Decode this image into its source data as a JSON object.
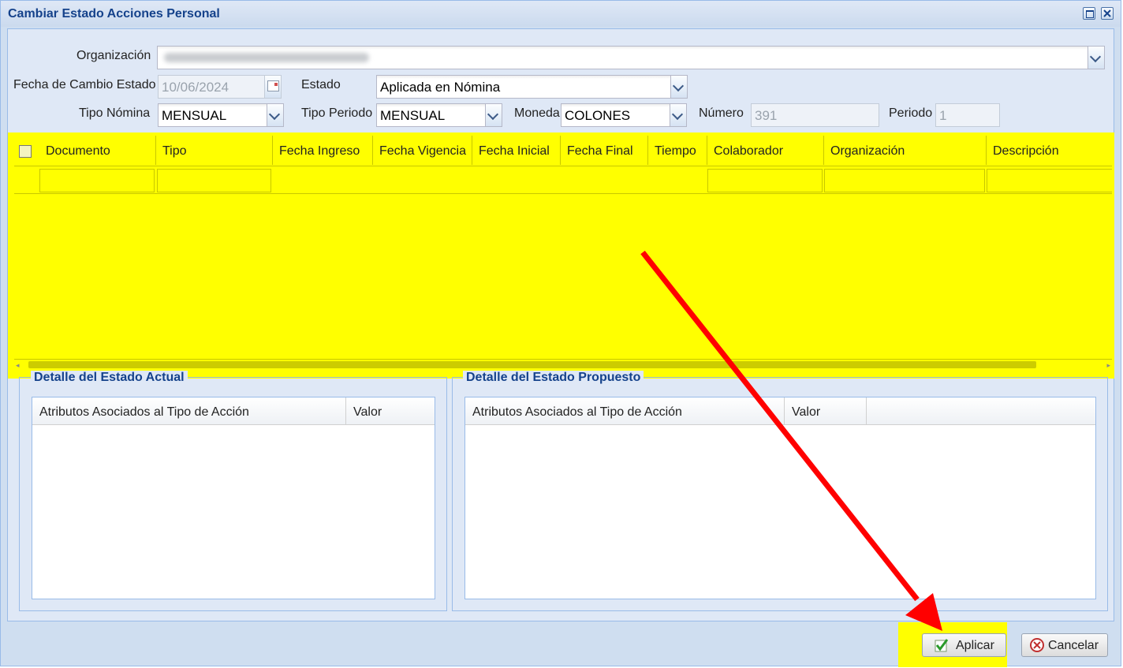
{
  "window": {
    "title": "Cambiar Estado Acciones Personal"
  },
  "form": {
    "organizacion": {
      "label": "Organización"
    },
    "fecha_cambio": {
      "label": "Fecha de Cambio Estado",
      "value": "10/06/2024"
    },
    "estado": {
      "label": "Estado",
      "value": "Aplicada en Nómina"
    },
    "tipo_nomina": {
      "label": "Tipo Nómina",
      "value": "MENSUAL"
    },
    "tipo_periodo": {
      "label": "Tipo Periodo",
      "value": "MENSUAL"
    },
    "moneda": {
      "label": "Moneda",
      "value": "COLONES"
    },
    "numero": {
      "label": "Número",
      "value": "391"
    },
    "periodo": {
      "label": "Periodo",
      "value": "1"
    }
  },
  "grid": {
    "columns": [
      "Documento",
      "Tipo",
      "Fecha Ingreso",
      "Fecha Vigencia",
      "Fecha Inicial",
      "Fecha Final",
      "Tiempo",
      "Colaborador",
      "Organización",
      "Descripción"
    ],
    "highlight_color": "#ffff00"
  },
  "detalle_actual": {
    "title": "Detalle del Estado Actual",
    "col_atributos": "Atributos Asociados al Tipo de Acción",
    "col_valor": "Valor"
  },
  "detalle_propuesto": {
    "title": "Detalle del Estado Propuesto",
    "col_atributos": "Atributos Asociados al Tipo de Acción",
    "col_valor": "Valor"
  },
  "buttons": {
    "aplicar": "Aplicar",
    "cancelar": "Cancelar"
  },
  "annotation": {
    "arrow_color": "#ff0000"
  }
}
